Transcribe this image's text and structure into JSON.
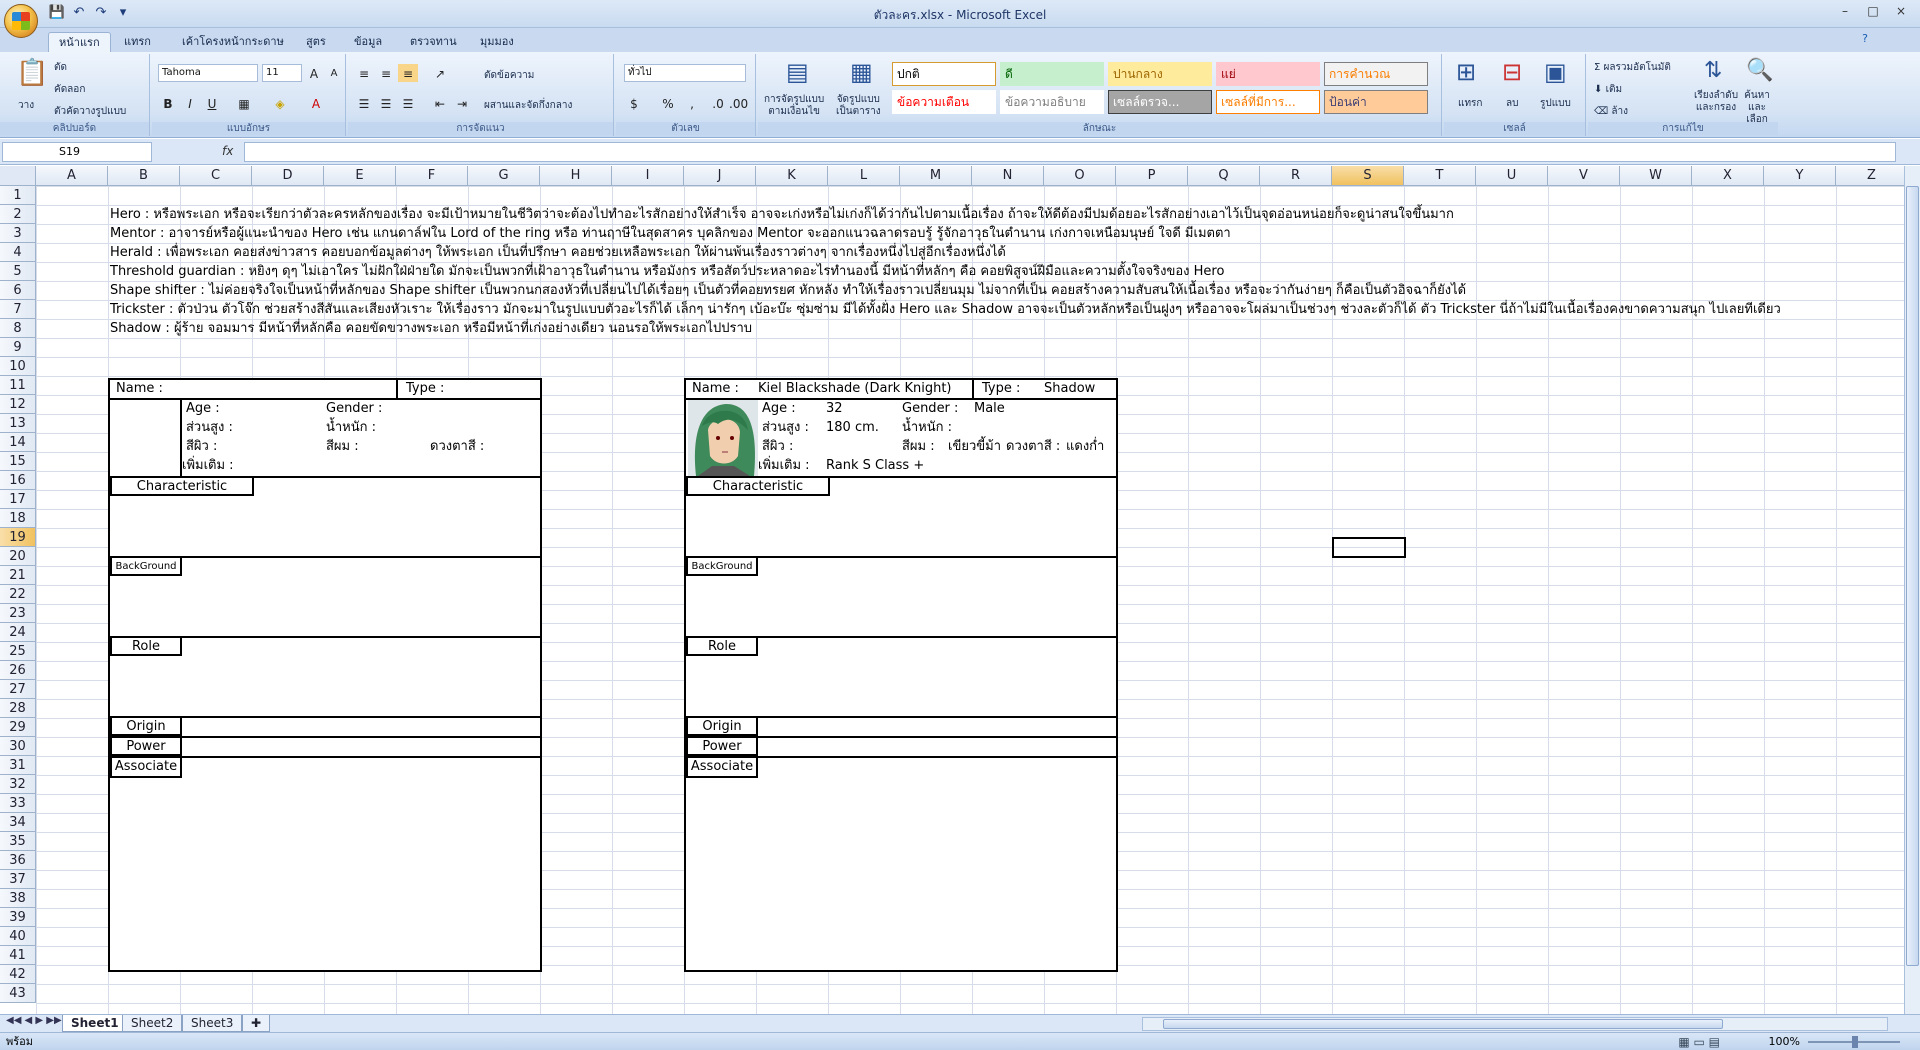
{
  "window": {
    "title": "ตัวละคร.xlsx - Microsoft Excel",
    "controls": [
      "–",
      "□",
      "×"
    ]
  },
  "ribbon_tabs": [
    "หน้าแรก",
    "แทรก",
    "เค้าโครงหน้ากระดาษ",
    "สูตร",
    "ข้อมูล",
    "ตรวจทาน",
    "มุมมอง"
  ],
  "ribbon": {
    "clipboard": {
      "paste": "วาง",
      "cut": "ตัด",
      "copy": "คัดลอก",
      "format_painter": "ตัวคัดวางรูปแบบ",
      "label": "คลิปบอร์ด"
    },
    "font": {
      "name": "Tahoma",
      "size": "11",
      "label": "แบบอักษร"
    },
    "alignment": {
      "wrap": "ตัดข้อความ",
      "merge": "ผสานและจัดกึ่งกลาง",
      "label": "การจัดแนว"
    },
    "number": {
      "format": "ทั่วไป",
      "percent": "%",
      "comma": ",",
      "label": "ตัวเลข"
    },
    "styles": {
      "conditional": "การจัดรูปแบบ\nตามเงื่อนไข",
      "as_table": "จัดรูปแบบ\nเป็นตาราง",
      "cells": [
        {
          "text": "ปกติ",
          "bg": "#ffffff",
          "fg": "#000000",
          "border": "#d59b2f"
        },
        {
          "text": "ดี",
          "bg": "#c6efce",
          "fg": "#006100",
          "border": "#c6efce"
        },
        {
          "text": "ปานกลาง",
          "bg": "#ffeb9c",
          "fg": "#9c6500",
          "border": "#ffeb9c"
        },
        {
          "text": "แย่",
          "bg": "#ffc7ce",
          "fg": "#9c0006",
          "border": "#ffc7ce"
        },
        {
          "text": "การคำนวณ",
          "bg": "#f2f2f2",
          "fg": "#fa7d00",
          "border": "#7f7f7f"
        },
        {
          "text": "ข้อความเตือน",
          "bg": "#ffffff",
          "fg": "#ff0000",
          "border": "#ffffff"
        },
        {
          "text": "ข้อความอธิบาย",
          "bg": "#ffffff",
          "fg": "#7f7f7f",
          "border": "#ffffff"
        },
        {
          "text": "เซลล์ตรวจ...",
          "bg": "#a5a5a5",
          "fg": "#ffffff",
          "border": "#3f3f3f"
        },
        {
          "text": "เซลล์ที่มีการ...",
          "bg": "#ffffff",
          "fg": "#fa7d00",
          "border": "#ff8001"
        },
        {
          "text": "ป้อนค่า",
          "bg": "#ffcc99",
          "fg": "#3f3f76",
          "border": "#7f7f7f"
        }
      ],
      "label": "ลักษณะ"
    },
    "cells": {
      "insert": "แทรก",
      "delete": "ลบ",
      "format": "รูปแบบ",
      "label": "เซลล์"
    },
    "editing": {
      "autosum": "ผลรวมอัตโนมัติ",
      "fill": "เติม",
      "clear": "ล้าง",
      "sort": "เรียงลำดับ\nและกรอง",
      "find": "ค้นหาและ\nเลือก",
      "label": "การแก้ไข"
    }
  },
  "formula_bar": {
    "name_box": "S19",
    "fx": "fx",
    "content": ""
  },
  "columns": [
    "A",
    "B",
    "C",
    "D",
    "E",
    "F",
    "G",
    "H",
    "I",
    "J",
    "K",
    "L",
    "M",
    "N",
    "O",
    "P",
    "Q",
    "R",
    "S",
    "T",
    "U",
    "V",
    "W",
    "X",
    "Y",
    "Z"
  ],
  "selected_column": "S",
  "rows": [
    "1",
    "2",
    "3",
    "4",
    "5",
    "6",
    "7",
    "8",
    "9",
    "10",
    "11",
    "12",
    "13",
    "14",
    "15",
    "16",
    "17",
    "18",
    "19",
    "20",
    "21",
    "22",
    "23",
    "24",
    "25",
    "26",
    "27",
    "28",
    "29",
    "30",
    "31",
    "32",
    "33",
    "34",
    "35",
    "36",
    "37",
    "38",
    "39",
    "40",
    "41",
    "42",
    "43"
  ],
  "selected_row": "19",
  "notes": [
    "Hero : หรือพระเอก หรือจะเรียกว่าตัวละครหลักของเรื่อง จะมีเป้าหมายในชีวิตว่าจะต้องไปทำอะไรสักอย่างให้สำเร็จ อาจจะเก่งหรือไม่เก่งก็ได้ว่ากันไปตามเนื้อเรื่อง ถ้าจะให้ดีต้องมีปมด้อยอะไรสักอย่างเอาไว้เป็นจุดอ่อนหน่อยก็จะดูน่าสนใจขึ้นมาก",
    "Mentor : อาจารย์หรือผู้แนะนำของ Hero เช่น แกนดาล์ฟใน Lord of the ring หรือ ท่านฤาษีในสุดสาคร บุคลิกของ Mentor จะออกแนวฉลาดรอบรู้ รู้จักอาวุธในตำนาน เก่งกาจเหนือมนุษย์ ใจดี มีเมตตา",
    "Herald : เพื่อพระเอก คอยส่งข่าวสาร คอยบอกข้อมูลต่างๆ ให้พระเอก เป็นที่ปรึกษา คอยช่วยเหลือพระเอก ให้ผ่านพ้นเรื่องราวต่างๆ จากเรื่องหนึ่งไปสู่อีกเรื่องหนึ่งได้",
    "Threshold guardian : หยิงๆ ดุๆ ไม่เอาใคร ไม่ฝักใฝ่ฝ่ายใด มักจะเป็นพวกที่เฝ้าอาวุธในตำนาน หรือมังกร หรือสัตว์ประหลาดอะไรทำนองนี้ มีหน้าที่หลักๆ คือ คอยพิสูจน์ฝีมือและความตั้งใจจริงของ Hero",
    "Shape shifter : ไม่ค่อยจริงใจเป็นหน้าที่หลักของ Shape shifter เป็นพวกนกสองหัวที่เปลี่ยนไปได้เรื่อยๆ เป็นตัวที่คอยทรยศ หักหลัง ทำให้เรื่องราวเปลี่ยนมุม ไม่จากที่เป็น คอยสร้างความสับสนให้เนื้อเรื่อง หรือจะว่ากันง่ายๆ ก็คือเป็นตัวอิจฉาก็ยังได้",
    "Trickster : ตัวป่วน ตัวโจ๊ก ช่วยสร้างสีสันและเสียงหัวเราะ ให้เรื่องราว มักจะมาในรูปแบบตัวอะไรก็ได้ เล็กๆ น่ารักๆ เบ้อะบ๊ะ ซุ่มซ่าม มีได้ทั้งฝั่ง Hero และ Shadow อาจจะเป็นตัวหลักหรือเป็นฝูงๆ หรืออาจจะโผล่มาเป็นช่วงๆ ช่วงละตัวก็ได้ ตัว Trickster นี่ถ้าไม่มีในเนื้อเรื่องคงขาดความสนุก ไปเลยทีเดียว",
    "Shadow : ผู้ร้าย จอมมาร มีหน้าที่หลักคือ คอยขัดขวางพระเอก หรือมีหน้าที่เก่งอย่างเดียว นอนรอให้พระเอกไปปราบ"
  ],
  "form_blank": {
    "name_label": "Name :",
    "name_value": "",
    "type_label": "Type :",
    "type_value": "",
    "age_label": "Age :",
    "age_value": "",
    "gender_label": "Gender :",
    "gender_value": "",
    "height_label": "ส่วนสูง :",
    "height_value": "",
    "weight_label": "น้ำหนัก :",
    "weight_value": "",
    "skin_label": "สีผิว :",
    "skin_value": "",
    "hair_label": "สีผม :",
    "hair_value": "",
    "eye_label": "ดวงตาสี :",
    "eye_value": "",
    "extra_label": "เพิ่มเติม :",
    "extra_value": "",
    "characteristic": "Characteristic",
    "background": "BackGround",
    "role": "Role",
    "origin": "Origin",
    "power": "Power",
    "associate": "Associate"
  },
  "form_filled": {
    "name_label": "Name :",
    "name_value": "Kiel Blackshade (Dark Knight)",
    "type_label": "Type :",
    "type_value": "Shadow",
    "age_label": "Age :",
    "age_value": "32",
    "gender_label": "Gender :",
    "gender_value": "Male",
    "height_label": "ส่วนสูง :",
    "height_value": "180 cm.",
    "weight_label": "น้ำหนัก :",
    "weight_value": "",
    "skin_label": "สีผิว :",
    "skin_value": "",
    "hair_label": "สีผม :",
    "hair_value": "เขียวขี้ม้า",
    "eye_label": "ดวงตาสี :",
    "eye_value": "แดงก่ำ",
    "extra_label": "เพิ่มเติม :",
    "extra_value": "Rank S Class +",
    "characteristic": "Characteristic",
    "background": "BackGround",
    "role": "Role",
    "origin": "Origin",
    "power": "Power",
    "associate": "Associate"
  },
  "sheet_tabs": [
    "Sheet1",
    "Sheet2",
    "Sheet3"
  ],
  "active_sheet": "Sheet1",
  "status": {
    "ready": "พร้อม",
    "zoom": "100%"
  }
}
